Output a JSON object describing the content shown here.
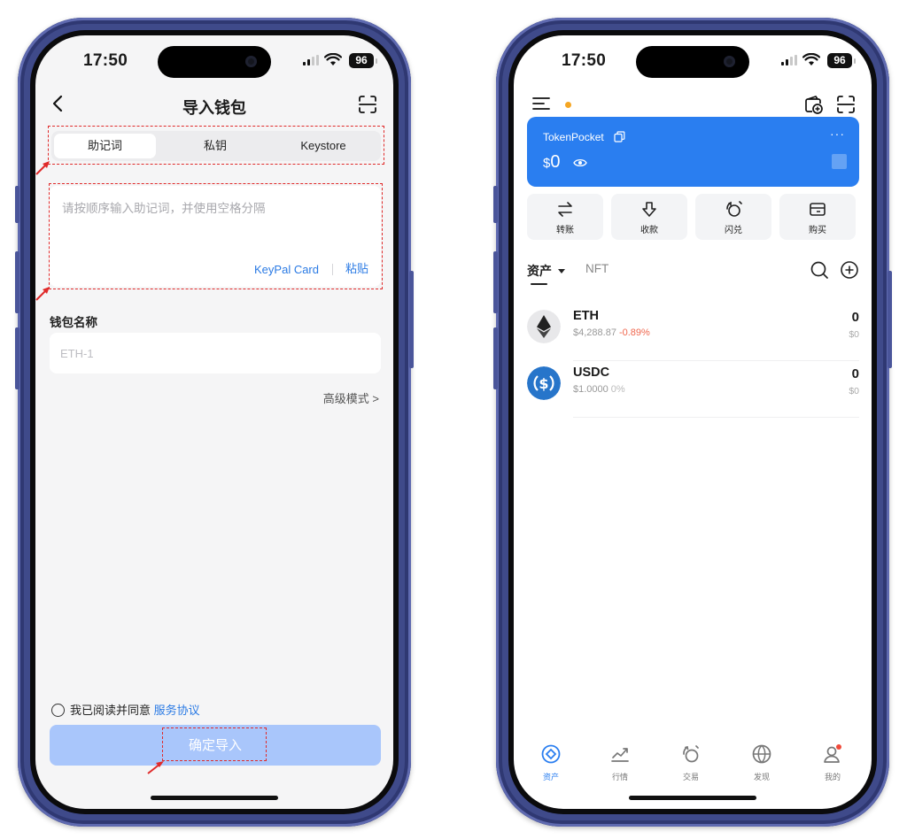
{
  "status_bar": {
    "time": "17:50",
    "battery": "96"
  },
  "import_screen": {
    "title": "导入钱包",
    "tabs": [
      {
        "label": "助记词",
        "active": true
      },
      {
        "label": "私钥",
        "active": false
      },
      {
        "label": "Keystore",
        "active": false
      }
    ],
    "mnemonic_placeholder": "请按顺序输入助记词，并使用空格分隔",
    "keypal_label": "KeyPal Card",
    "paste_label": "粘贴",
    "wallet_name_label": "钱包名称",
    "wallet_name_placeholder": "ETH-1",
    "advanced_mode_label": "高级模式 >",
    "agreement_text": "我已阅读并同意",
    "agreement_link": "服务协议",
    "confirm_label": "确定导入"
  },
  "wallet_screen": {
    "wallet_name": "TokenPocket",
    "more": "···",
    "balance_currency": "$",
    "balance": "0",
    "actions": [
      {
        "label": "转账",
        "icon": "transfer-icon"
      },
      {
        "label": "收款",
        "icon": "receive-icon"
      },
      {
        "label": "闪兑",
        "icon": "swap-icon"
      },
      {
        "label": "购买",
        "icon": "card-icon"
      }
    ],
    "asset_tab": "资产",
    "nft_tab": "NFT",
    "tokens": [
      {
        "symbol": "ETH",
        "price": "$4,288.87",
        "change": "-0.89%",
        "amount": "0",
        "value": "$0",
        "change_color": "#f0674e"
      },
      {
        "symbol": "USDC",
        "price": "$1.0000",
        "change": "0%",
        "amount": "0",
        "value": "$0",
        "change_color": "#bbbbbb"
      }
    ],
    "bottom_tabs": [
      {
        "label": "资产",
        "icon": "asset-icon",
        "active": true
      },
      {
        "label": "行情",
        "icon": "market-icon",
        "active": false
      },
      {
        "label": "交易",
        "icon": "trade-icon",
        "active": false
      },
      {
        "label": "发现",
        "icon": "discover-icon",
        "active": false
      },
      {
        "label": "我的",
        "icon": "profile-icon",
        "active": false
      }
    ]
  },
  "colors": {
    "accent": "#2a7ef0",
    "link": "#2a7ae4",
    "annotation_red": "#e02a2a",
    "confirm_disabled": "#a9c6fb",
    "frame": "#3f4a8a"
  }
}
